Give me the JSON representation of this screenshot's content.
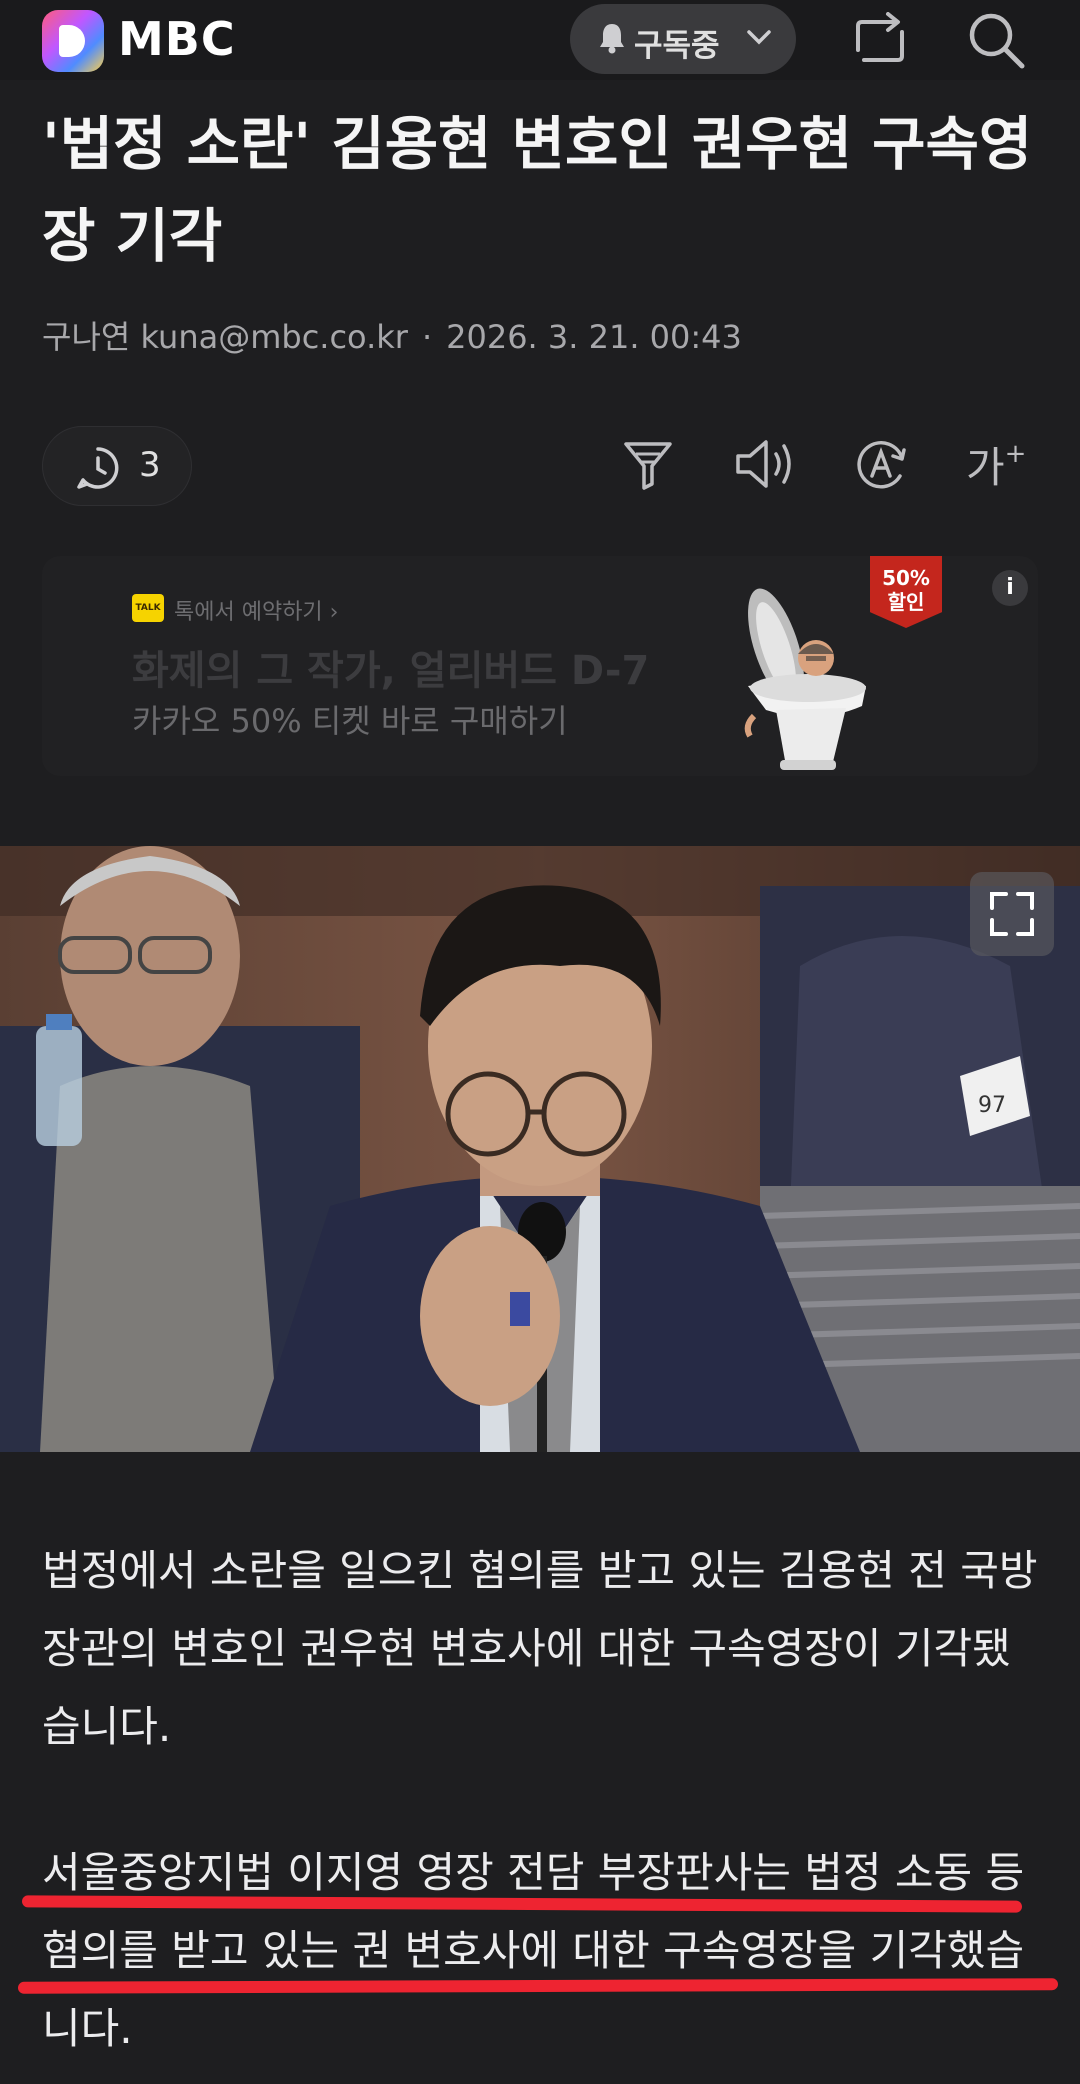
{
  "header": {
    "brand": "MBC",
    "subscribe_label": "구독중",
    "share_icon": "share-icon",
    "search_icon": "search-icon"
  },
  "article": {
    "headline": "'법정 소란' 김용현 변호인 권우현 구속영장 기각",
    "reporter": "구나연 kuna@mbc.co.kr",
    "date": "2026. 3. 21. 00:43",
    "comment_count": "3",
    "paragraph1": "법정에서 소란을 일으킨 혐의를 받고 있는 김용현 전 국방장관의 변호인 권우현 변호사에 대한 구속영장이 기각됐습니다.",
    "paragraph2": "서울중앙지법 이지영 영장 전담 부장판사는 법정 소동 등 혐의를 받고 있는 권 변호사에 대한 구속영장을 기각했습니다."
  },
  "toolbar": {
    "filter_icon": "filter-icon",
    "speaker_icon": "speaker-icon",
    "translate_icon": "translate-icon",
    "font_size_label": "가"
  },
  "ad": {
    "talk_badge": "TALK",
    "talk_text": "톡에서 예약하기 ›",
    "title": "화제의 그 작가, 얼리버드 D-7",
    "desc": "카카오 50% 티켓 바로 구매하기",
    "badge_line1": "50%",
    "badge_line2": "할인",
    "info": "i"
  },
  "photo": {
    "tag_number": "97"
  },
  "colors": {
    "background": "#1e1e20",
    "highlight": "#ee2431",
    "badge": "#c4261d"
  }
}
